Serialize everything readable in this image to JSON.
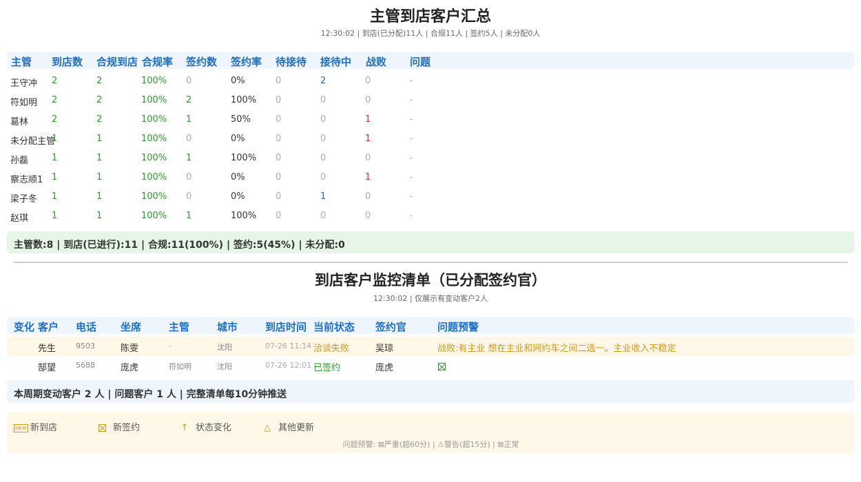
{
  "summary_section": {
    "title": "主管到店客户汇总",
    "subtitle": "12:30:02 | 到店(已分配)11人 | 合规11人 | 签约5人 | 未分配0人",
    "headers": [
      "主管",
      "到店数",
      "合规到店",
      "合规率",
      "签约数",
      "签约率",
      "待接待",
      "接待中",
      "战败",
      "问题"
    ],
    "rows": [
      {
        "name": "王守冲",
        "arrive": "2",
        "compliant": "2",
        "rate": "100%",
        "signed": "0",
        "sign_rate": "0%",
        "waiting": "0",
        "serving": "2",
        "lost": "0",
        "issue": "-"
      },
      {
        "name": "符如明",
        "arrive": "2",
        "compliant": "2",
        "rate": "100%",
        "signed": "2",
        "sign_rate": "100%",
        "waiting": "0",
        "serving": "0",
        "lost": "0",
        "issue": "-"
      },
      {
        "name": "葛林",
        "arrive": "2",
        "compliant": "2",
        "rate": "100%",
        "signed": "1",
        "sign_rate": "50%",
        "waiting": "0",
        "serving": "0",
        "lost": "1",
        "issue": "-"
      },
      {
        "name": "未分配主管",
        "arrive": "1",
        "compliant": "1",
        "rate": "100%",
        "signed": "0",
        "sign_rate": "0%",
        "waiting": "0",
        "serving": "0",
        "lost": "1",
        "issue": "-"
      },
      {
        "name": "孙磊",
        "arrive": "1",
        "compliant": "1",
        "rate": "100%",
        "signed": "1",
        "sign_rate": "100%",
        "waiting": "0",
        "serving": "0",
        "lost": "0",
        "issue": "-"
      },
      {
        "name": "察志顺1",
        "arrive": "1",
        "compliant": "1",
        "rate": "100%",
        "signed": "0",
        "sign_rate": "0%",
        "waiting": "0",
        "serving": "0",
        "lost": "1",
        "issue": "-"
      },
      {
        "name": "梁子冬",
        "arrive": "1",
        "compliant": "1",
        "rate": "100%",
        "signed": "0",
        "sign_rate": "0%",
        "waiting": "0",
        "serving": "1",
        "lost": "0",
        "issue": "-"
      },
      {
        "name": "赵琪",
        "arrive": "1",
        "compliant": "1",
        "rate": "100%",
        "signed": "1",
        "sign_rate": "100%",
        "waiting": "0",
        "serving": "0",
        "lost": "0",
        "issue": "-"
      }
    ],
    "totals": "主管数:8 | 到店(已进行):11 | 合规:11(100%) | 签约:5(45%) | 未分配:0"
  },
  "monitor_section": {
    "title": "到店客户监控清单（已分配签约官）",
    "subtitle": "12:30:02 | 仅展示有变动客户2人",
    "headers": [
      "变化",
      "客户",
      "电话",
      "坐席",
      "主管",
      "城市",
      "到店时间",
      "当前状态",
      "签约官",
      "问题预警"
    ],
    "rows": [
      {
        "change": "",
        "customer": "先生",
        "phone": "9503",
        "agent": "陈雯",
        "supervisor": "-",
        "city": "沈阳",
        "time": "07-26 11:14",
        "status": "洽谈失败",
        "officer": "吴琼",
        "warning": "战败:有主业 想在主业和网约车之间二选一。主业收入不稳定"
      },
      {
        "change": "",
        "customer": "郜望",
        "phone": "5688",
        "agent": "庞虎",
        "supervisor": "符如明",
        "city": "沈阳",
        "time": "07-26 12:01",
        "status": "已签约",
        "officer": "庞虎",
        "warning": ""
      }
    ],
    "totals": "本周期变动客户 2 人 | 问题客户 1 人 | 完整清单每10分钟推送"
  },
  "legend": {
    "items": [
      {
        "icon": "new-icon",
        "label": "新到店"
      },
      {
        "icon": "checkbox-x-icon",
        "label": "新签约"
      },
      {
        "icon": "arrow-up-icon",
        "label": "状态变化"
      },
      {
        "icon": "triangle-icon",
        "label": "其他更新"
      }
    ],
    "note": "问题预警: ⊠严重(超60分) | ⚠警告(超15分) | ⊠正常"
  },
  "colors": {
    "accent": "#1f6fc4",
    "green": "#2a9a2a",
    "red": "#d32f2f",
    "orange": "#d89614"
  }
}
